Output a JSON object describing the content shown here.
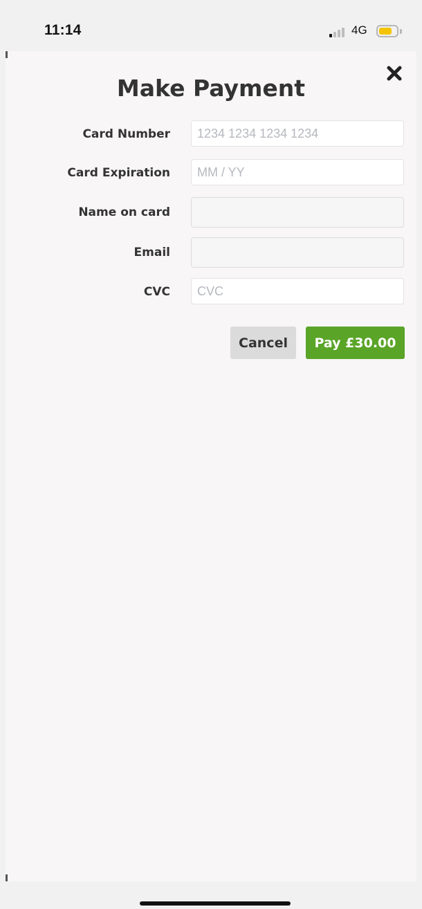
{
  "status_bar": {
    "time": "11:14",
    "network": "4G",
    "signal_bars_active": 1,
    "signal_bars_total": 4,
    "battery_level": 0.75,
    "battery_color": "#f5c400"
  },
  "modal": {
    "title": "Make Payment",
    "close_icon": "close-x-icon",
    "fields": [
      {
        "label": "Card Number",
        "placeholder": "1234 1234 1234 1234",
        "value": ""
      },
      {
        "label": "Card Expiration",
        "placeholder": "MM / YY",
        "value": ""
      },
      {
        "label": "Name on card",
        "placeholder": "",
        "value": ""
      },
      {
        "label": "Email",
        "placeholder": "",
        "value": ""
      },
      {
        "label": "CVC",
        "placeholder": "CVC",
        "value": ""
      }
    ],
    "buttons": {
      "cancel_label": "Cancel",
      "pay_label": "Pay £30.00"
    }
  },
  "colors": {
    "pay_button": "#5aa428",
    "cancel_button": "#dcdbdb",
    "sheet_background": "#f8f6f6"
  }
}
